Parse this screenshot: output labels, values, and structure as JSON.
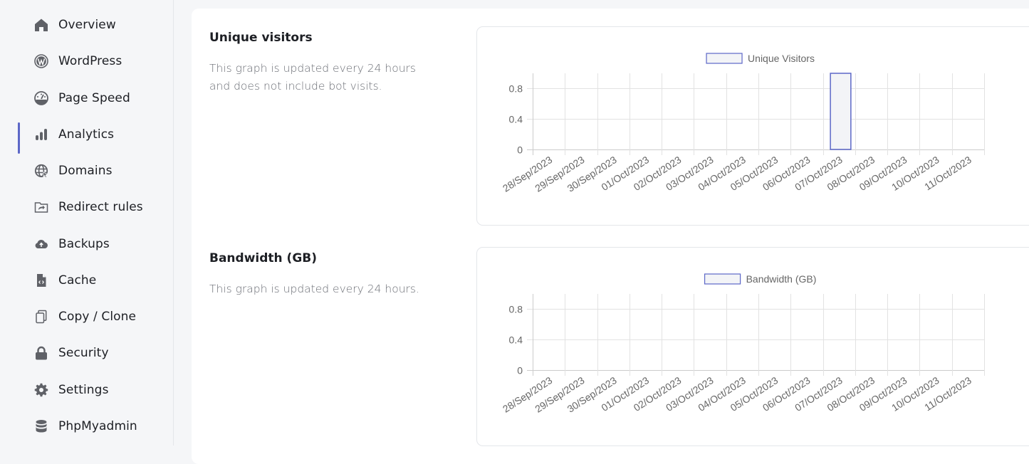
{
  "sidebar": {
    "items": [
      {
        "label": "Overview",
        "icon": "home-icon",
        "active": false
      },
      {
        "label": "WordPress",
        "icon": "wordpress-icon",
        "active": false
      },
      {
        "label": "Page Speed",
        "icon": "speedometer-icon",
        "active": false
      },
      {
        "label": "Analytics",
        "icon": "bar-chart-icon",
        "active": true
      },
      {
        "label": "Domains",
        "icon": "globe-icon",
        "active": false
      },
      {
        "label": "Redirect rules",
        "icon": "folder-redirect-icon",
        "active": false
      },
      {
        "label": "Backups",
        "icon": "cloud-upload-icon",
        "active": false
      },
      {
        "label": "Cache",
        "icon": "file-code-icon",
        "active": false
      },
      {
        "label": "Copy / Clone",
        "icon": "copy-icon",
        "active": false
      },
      {
        "label": "Security",
        "icon": "lock-icon",
        "active": false
      },
      {
        "label": "Settings",
        "icon": "gear-icon",
        "active": false
      },
      {
        "label": "PhpMyadmin",
        "icon": "database-icon",
        "active": false
      }
    ]
  },
  "sections": [
    {
      "title": "Unique visitors",
      "description": "This graph is updated every 24 hours and does not include bot visits."
    },
    {
      "title": "Bandwidth (GB)",
      "description": "This graph is updated every 24 hours."
    }
  ],
  "colors": {
    "accent": "#5c67c7",
    "bar_fill": "#f3f4f7",
    "grid": "#e2e2e2",
    "axis": "#cccccc"
  },
  "chart_data": [
    {
      "type": "bar",
      "title": "",
      "legend": [
        "Unique Visitors"
      ],
      "legend_position": "top",
      "categories": [
        "28/Sep/2023",
        "29/Sep/2023",
        "30/Sep/2023",
        "01/Oct/2023",
        "02/Oct/2023",
        "03/Oct/2023",
        "04/Oct/2023",
        "05/Oct/2023",
        "06/Oct/2023",
        "07/Oct/2023",
        "08/Oct/2023",
        "09/Oct/2023",
        "10/Oct/2023",
        "11/Oct/2023"
      ],
      "series": [
        {
          "name": "Unique Visitors",
          "values": [
            0,
            0,
            0,
            0,
            0,
            0,
            0,
            0,
            0,
            1,
            0,
            0,
            0,
            0
          ]
        }
      ],
      "yticks": [
        "0",
        "0.4",
        "0.8"
      ],
      "ylim": [
        0,
        1
      ],
      "xlabel": "",
      "ylabel": "",
      "grid": true
    },
    {
      "type": "bar",
      "title": "",
      "legend": [
        "Bandwidth (GB)"
      ],
      "legend_position": "top",
      "categories": [
        "28/Sep/2023",
        "29/Sep/2023",
        "30/Sep/2023",
        "01/Oct/2023",
        "02/Oct/2023",
        "03/Oct/2023",
        "04/Oct/2023",
        "05/Oct/2023",
        "06/Oct/2023",
        "07/Oct/2023",
        "08/Oct/2023",
        "09/Oct/2023",
        "10/Oct/2023",
        "11/Oct/2023"
      ],
      "series": [
        {
          "name": "Bandwidth (GB)",
          "values": [
            0,
            0,
            0,
            0,
            0,
            0,
            0,
            0,
            0,
            0,
            0,
            0,
            0,
            0
          ]
        }
      ],
      "yticks": [
        "0",
        "0.4",
        "0.8"
      ],
      "ylim": [
        0,
        1
      ],
      "xlabel": "",
      "ylabel": "",
      "grid": true
    }
  ]
}
